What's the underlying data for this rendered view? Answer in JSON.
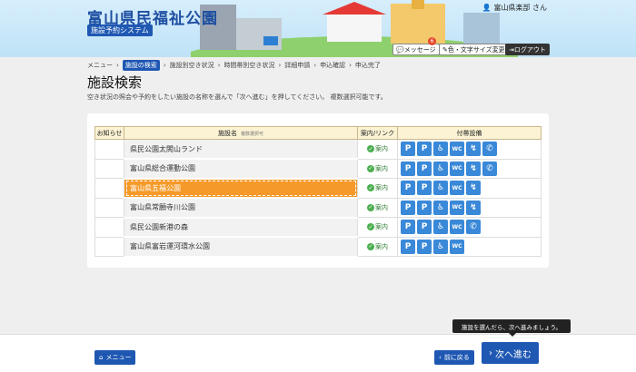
{
  "header": {
    "title": "富山県民福祉公園",
    "subtitle": "施設予約システム",
    "user_label": "富山県楽部 さん",
    "message_button": "メッセージ",
    "message_count": "6",
    "display_button": "色・文字サイズ変更",
    "logout_button": "ログアウト"
  },
  "breadcrumb": [
    "メニュー",
    "施設の検索",
    "施設別空き状況",
    "時間帯別空き状況",
    "詳細申請",
    "申込確認",
    "申込完了"
  ],
  "page": {
    "title": "施設検索",
    "instruction": "空き状況の照会や予約をしたい施設の名称を選んで「次へ進む」を押してください。 複数選択可能です。"
  },
  "table": {
    "headers": {
      "notice": "お知らせ",
      "name": "施設名",
      "name_note": "複数選択可",
      "link": "案内/リンク",
      "facilities": "付帯設備"
    },
    "guide_label": "案内",
    "rows": [
      {
        "name": "県民公園太閤山ランド",
        "selected": false
      },
      {
        "name": "富山県総合運動公園",
        "selected": false
      },
      {
        "name": "富山県五福公園",
        "selected": true
      },
      {
        "name": "富山県常願寺川公園",
        "selected": false
      },
      {
        "name": "県民公園新港の森",
        "selected": false
      },
      {
        "name": "富山県富岩運河環水公園",
        "selected": false
      }
    ]
  },
  "footer": {
    "menu_button": "メニュー",
    "back_button": "前に戻る",
    "next_button": "次へ進む",
    "tooltip": "施設を選んだら、次へ進みましょう。"
  }
}
